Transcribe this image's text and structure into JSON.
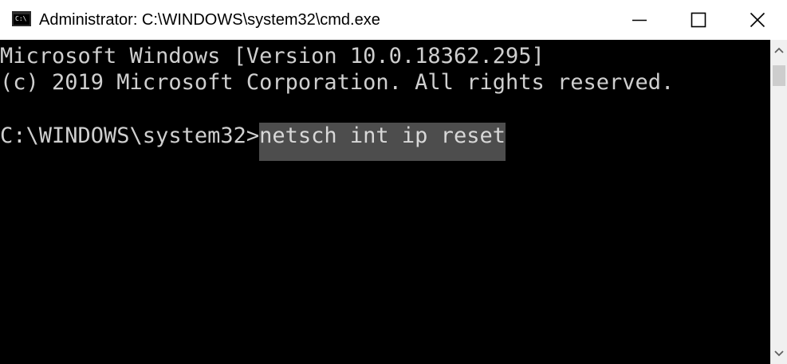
{
  "window": {
    "title": "Administrator: C:\\WINDOWS\\system32\\cmd.exe",
    "app_icon_text": "C:\\"
  },
  "console": {
    "line1": "Microsoft Windows [Version 10.0.18362.295]",
    "line2": "(c) 2019 Microsoft Corporation. All rights reserved.",
    "prompt": "C:\\WINDOWS\\system32>",
    "command": "netsch int ip reset"
  },
  "icons": {
    "minimize": "minimize-icon",
    "maximize": "maximize-icon",
    "close": "close-icon",
    "scroll_up": "scroll-up-arrow-icon",
    "scroll_down": "scroll-down-arrow-icon"
  },
  "colors": {
    "titlebar_bg": "#ffffff",
    "console_bg": "#000000",
    "console_text": "#cfcfcf",
    "selection_bg": "#4d4d4d",
    "scrollbar_bg": "#f0f0f0"
  }
}
